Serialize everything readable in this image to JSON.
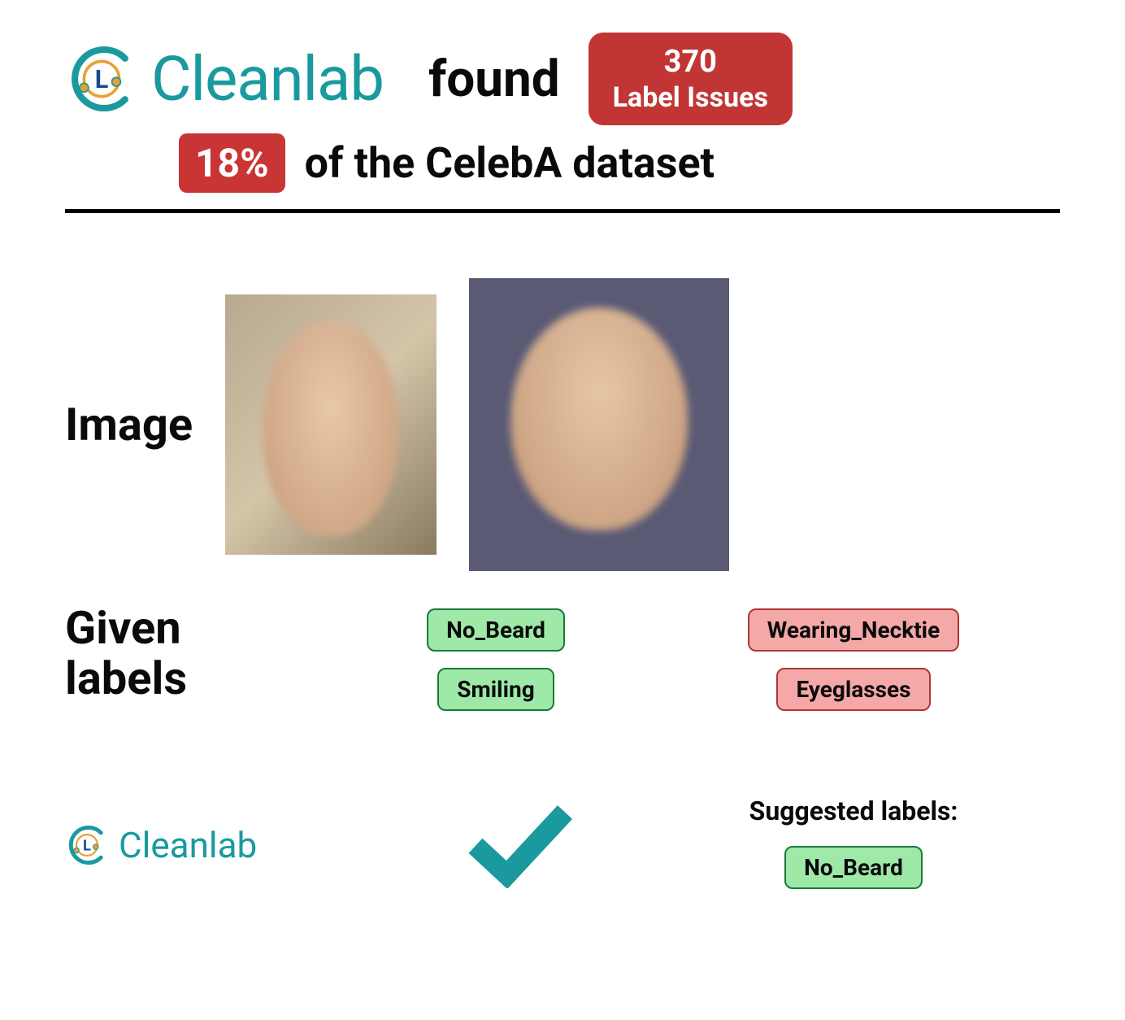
{
  "brand": {
    "name": "Cleanlab",
    "color": "#1a9a9e",
    "accent": "#e8a030"
  },
  "header": {
    "found_text": "found",
    "issues_count": "370",
    "issues_label": "Label Issues"
  },
  "subheader": {
    "percent": "18%",
    "text": "of the CelebA dataset"
  },
  "rows": {
    "image_label": "Image",
    "given_labels_label_line1": "Given",
    "given_labels_label_line2": "labels"
  },
  "examples": [
    {
      "given_labels": [
        "No_Beard",
        "Smiling"
      ],
      "label_style": "green",
      "cleanlab_result": "ok"
    },
    {
      "given_labels": [
        "Wearing_Necktie",
        "Eyeglasses"
      ],
      "label_style": "red",
      "cleanlab_result": "suggested",
      "suggested_heading": "Suggested labels:",
      "suggested_labels": [
        "No_Beard"
      ]
    }
  ],
  "colors": {
    "red_badge": "#c13535",
    "green_chip": "#9ee8a8",
    "red_chip": "#f5a8a8",
    "teal": "#1a9a9e"
  }
}
